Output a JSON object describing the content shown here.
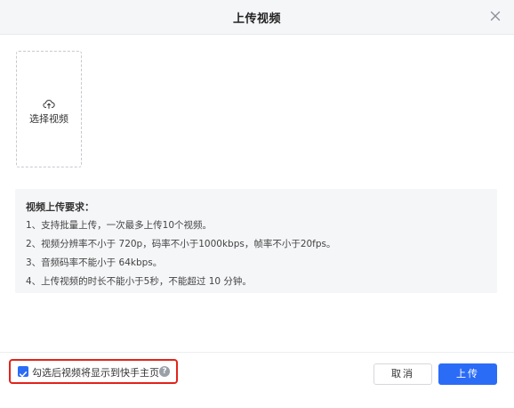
{
  "dialog": {
    "title": "上传视频",
    "close_icon": "close-icon"
  },
  "upload": {
    "icon": "upload-cloud-icon",
    "label": "选择视频"
  },
  "requirements": {
    "title": "视频上传要求：",
    "items": [
      "1、支持批量上传，一次最多上传10个视频。",
      "2、视频分辨率不小于 720p，码率不小于1000kbps，帧率不小于20fps。",
      "3、音频码率不能小于 64kbps。",
      "4、上传视频的时长不能小于5秒，不能超过 10 分钟。"
    ]
  },
  "footer": {
    "option": {
      "checked": true,
      "label": "勾选后视频将显示到快手主页",
      "help_icon": "question-circle-icon",
      "help_glyph": "?"
    },
    "cancel_label": "取消",
    "upload_label": "上传"
  },
  "colors": {
    "accent": "#2b6cf6",
    "highlight_border": "#e2231a",
    "panel_bg": "#f5f6f8"
  }
}
